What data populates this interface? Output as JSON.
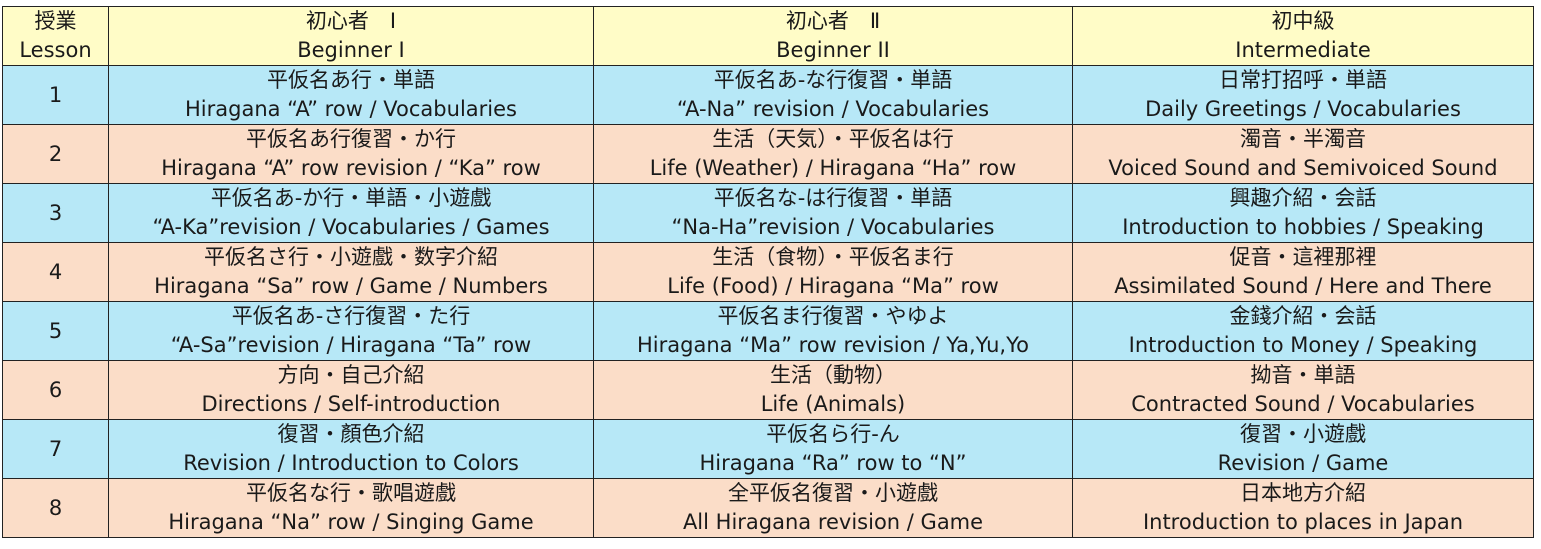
{
  "colors": {
    "header": "#FFFCC7",
    "blue_row": "#B7E8F7",
    "peach_row": "#FBDDC8",
    "border": "#222222"
  },
  "header": {
    "lesson": {
      "jp": "授業",
      "en": "Lesson"
    },
    "beginner1": {
      "jp": "初心者　Ⅰ",
      "en": "Beginner I"
    },
    "beginner2": {
      "jp": "初心者　Ⅱ",
      "en": "Beginner II"
    },
    "intermediate": {
      "jp": "初中級",
      "en": "Intermediate"
    }
  },
  "rows": [
    {
      "num": "1",
      "color": "blue",
      "b1": {
        "jp": "平仮名あ行・単語",
        "en": "Hiragana “A” row / Vocabularies"
      },
      "b2": {
        "jp": "平仮名あ-な行復習・単語",
        "en": "“A-Na” revision / Vocabularies"
      },
      "im": {
        "jp": "日常打招呼・単語",
        "en": "Daily Greetings / Vocabularies"
      }
    },
    {
      "num": "2",
      "color": "peach",
      "b1": {
        "jp": "平仮名あ行復習・か行",
        "en": "Hiragana “A” row revision / “Ka” row"
      },
      "b2": {
        "jp": "生活（天気）・平仮名は行",
        "en": "Life (Weather) / Hiragana “Ha” row"
      },
      "im": {
        "jp": "濁音・半濁音",
        "en": "Voiced Sound and Semivoiced Sound"
      }
    },
    {
      "num": "3",
      "color": "blue",
      "b1": {
        "jp": "平仮名あ-か行・単語・小遊戲",
        "en": "“A-Ka”revision / Vocabularies / Games"
      },
      "b2": {
        "jp": "平仮名な-は行復習・単語",
        "en": "“Na-Ha”revision / Vocabularies"
      },
      "im": {
        "jp": "興趣介紹・会話",
        "en": "Introduction to hobbies / Speaking"
      }
    },
    {
      "num": "4",
      "color": "peach",
      "b1": {
        "jp": "平仮名さ行・小遊戲・数字介紹",
        "en": "Hiragana “Sa” row / Game / Numbers"
      },
      "b2": {
        "jp": "生活（食物）・平仮名ま行",
        "en": "Life (Food) / Hiragana “Ma” row"
      },
      "im": {
        "jp": "促音・這裡那裡",
        "en": "Assimilated Sound / Here and There"
      }
    },
    {
      "num": "5",
      "color": "blue",
      "b1": {
        "jp": "平仮名あ-さ行復習・た行",
        "en": "“A-Sa”revision / Hiragana “Ta” row"
      },
      "b2": {
        "jp": "平仮名ま行復習・やゆよ",
        "en": "Hiragana “Ma” row revision / Ya,Yu,Yo"
      },
      "im": {
        "jp": "金錢介紹・会話",
        "en": "Introduction to Money / Speaking"
      }
    },
    {
      "num": "6",
      "color": "peach",
      "b1": {
        "jp": "方向・自己介紹",
        "en": "Directions / Self-introduction"
      },
      "b2": {
        "jp": "生活（動物）",
        "en": "Life (Animals)"
      },
      "im": {
        "jp": "拗音・単語",
        "en": "Contracted Sound / Vocabularies"
      }
    },
    {
      "num": "7",
      "color": "blue",
      "b1": {
        "jp": "復習・顏色介紹",
        "en": "Revision / Introduction to Colors"
      },
      "b2": {
        "jp": "平仮名ら行-ん",
        "en": "Hiragana “Ra” row to “N”"
      },
      "im": {
        "jp": "復習・小遊戲",
        "en": "Revision / Game"
      }
    },
    {
      "num": "8",
      "color": "peach",
      "b1": {
        "jp": "平仮名な行・歌唱遊戲",
        "en": "Hiragana “Na” row / Singing Game"
      },
      "b2": {
        "jp": "全平仮名復習・小遊戲",
        "en": "All Hiragana revision / Game"
      },
      "im": {
        "jp": "日本地方介紹",
        "en": "Introduction to places in Japan"
      }
    }
  ]
}
